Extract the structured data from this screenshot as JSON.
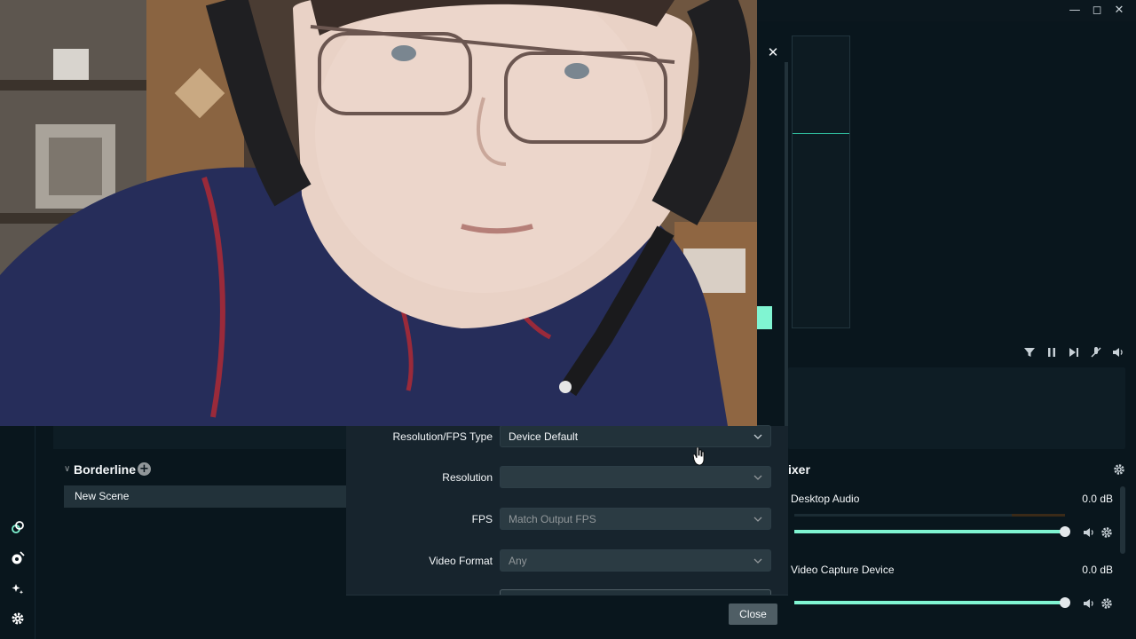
{
  "colors": {
    "accent": "#80f5d2",
    "background": "#09161d",
    "panel": "#17242d",
    "input": "#22323a",
    "button": "#4f5e65"
  },
  "window": {
    "controls": [
      "minimize-icon",
      "maximize-icon",
      "close-icon"
    ]
  },
  "nav": {
    "icons": [
      "studio-mode-icon",
      "themes-icon",
      "magic-icon",
      "settings-icon"
    ]
  },
  "scenes": {
    "collection": "Borderline",
    "items": [
      {
        "label": "New Scene"
      }
    ]
  },
  "sources_toolbar": {
    "icons": [
      "filter-icon",
      "pause-icon",
      "skip-icon",
      "mute-all-icon",
      "volume-icon"
    ]
  },
  "mixer": {
    "title": "ixer",
    "channels": [
      {
        "name": "Desktop Audio",
        "level": "0.0 dB",
        "volume": 1.0
      },
      {
        "name": "Video Capture Device",
        "level": "0.0 dB",
        "volume": 1.0
      }
    ]
  },
  "dialog": {
    "fields": [
      {
        "label": "Resolution/FPS Type",
        "value": "Device Default",
        "muted": false
      },
      {
        "label": "Resolution",
        "value": "",
        "muted": true
      },
      {
        "label": "FPS",
        "value": "Match Output FPS",
        "muted": true
      },
      {
        "label": "Video Format",
        "value": "Any",
        "muted": true
      }
    ],
    "close_label": "Close"
  },
  "preview": {
    "content": "webcam-feed"
  }
}
